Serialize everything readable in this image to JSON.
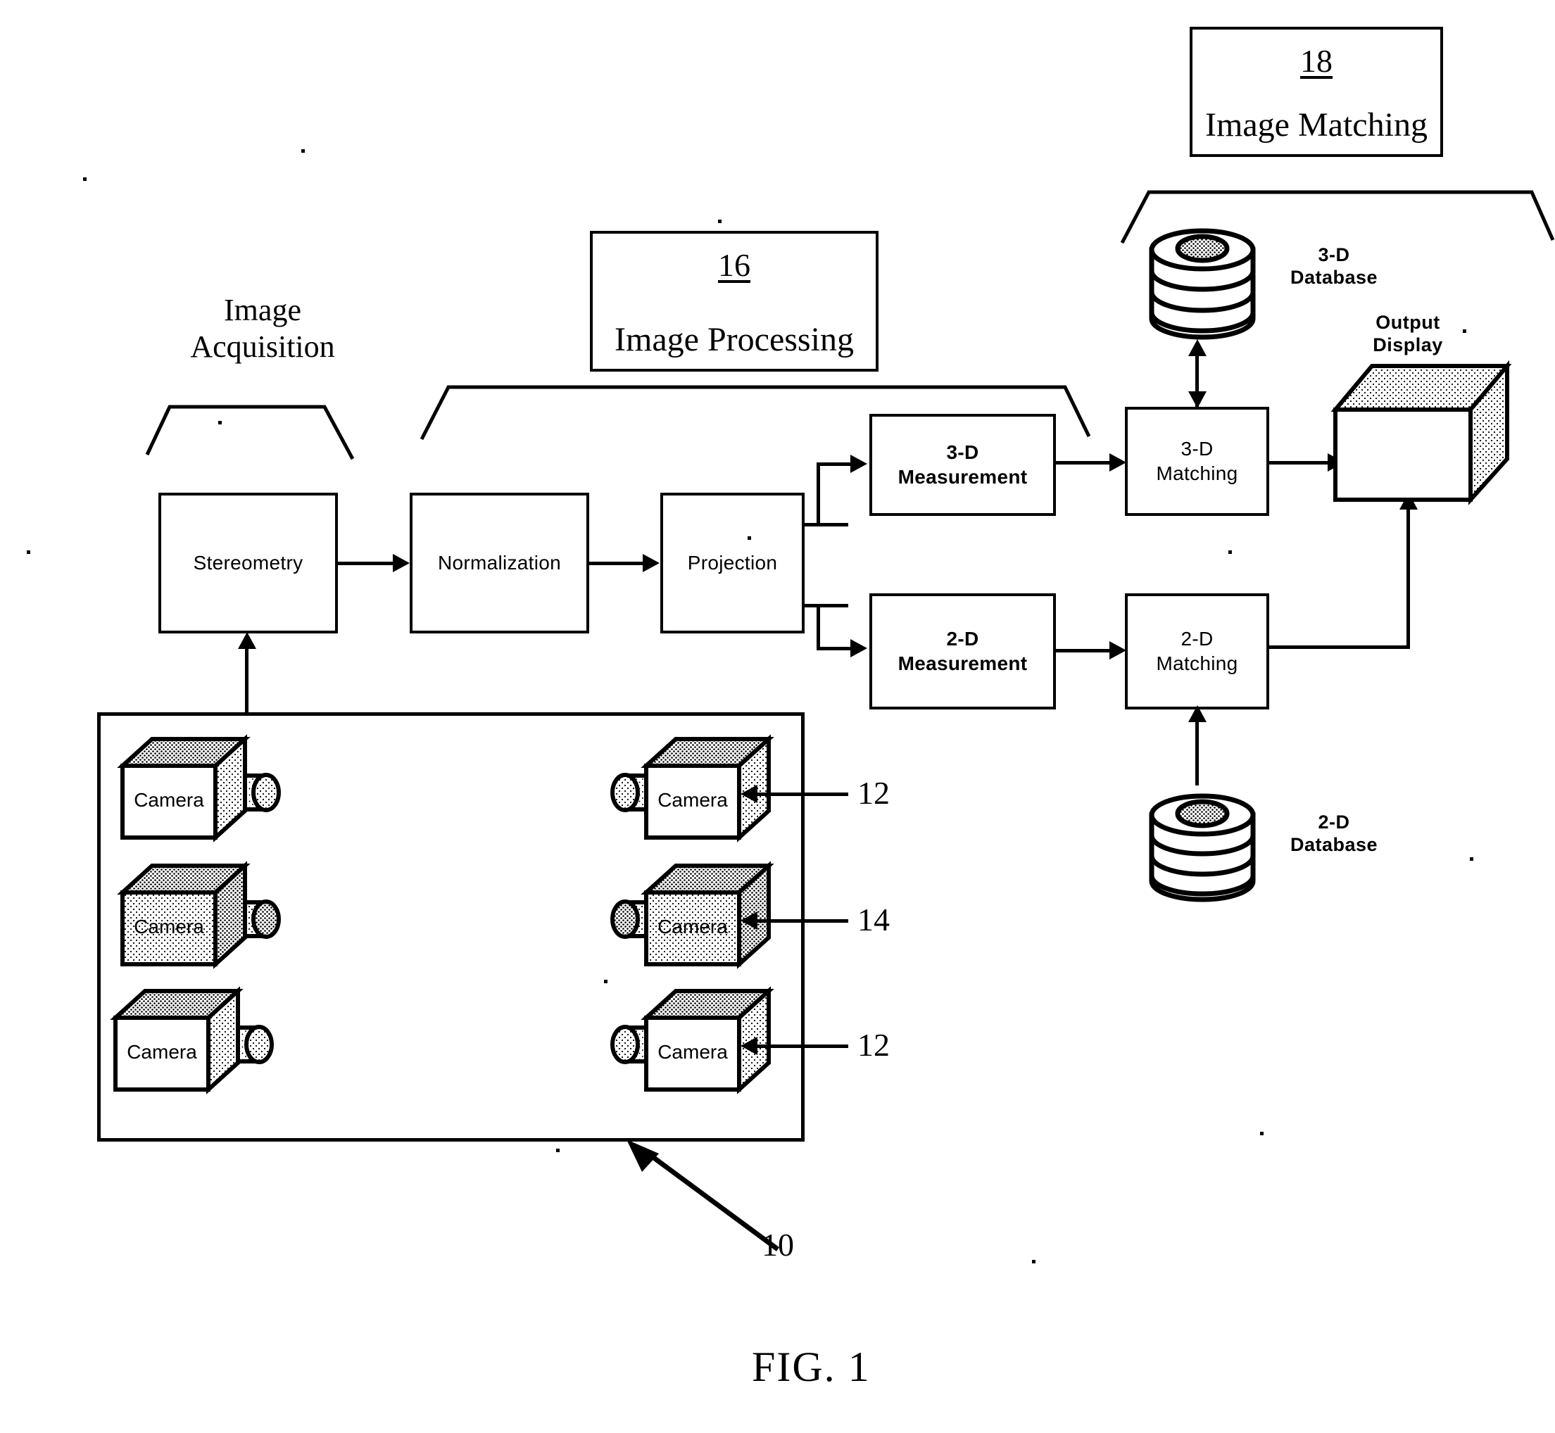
{
  "figure": {
    "caption": "FIG. 1",
    "reference_numbers": {
      "system": "10",
      "camera_a": "12",
      "camera_b": "14",
      "camera_c": "12",
      "image_processing": "16",
      "image_matching": "18"
    }
  },
  "groups": {
    "image_acquisition": {
      "label": "Image\nAcquisition"
    },
    "image_processing": {
      "number": "16",
      "title": "Image Processing"
    },
    "image_matching": {
      "number": "18",
      "title": "Image Matching"
    }
  },
  "process_boxes": {
    "stereometry": "Stereometry",
    "normalization": "Normalization",
    "projection": "Projection",
    "measurement_3d": "3-D\nMeasurement",
    "matching_3d": "3-D\nMatching",
    "measurement_2d": "2-D\nMeasurement",
    "matching_2d": "2-D\nMatching"
  },
  "databases": {
    "db_3d": "3-D\nDatabase",
    "db_2d": "2-D\nDatabase"
  },
  "output": {
    "display": "Output\nDisplay"
  },
  "cameras": [
    {
      "label": "Camera",
      "side": "left",
      "row": 1,
      "shaded": false
    },
    {
      "label": "Camera",
      "side": "right",
      "row": 1,
      "shaded": false,
      "ref": "12"
    },
    {
      "label": "Camera",
      "side": "left",
      "row": 2,
      "shaded": true
    },
    {
      "label": "Camera",
      "side": "right",
      "row": 2,
      "shaded": true,
      "ref": "14"
    },
    {
      "label": "Camera",
      "side": "left",
      "row": 3,
      "shaded": false
    },
    {
      "label": "Camera",
      "side": "right",
      "row": 3,
      "shaded": false,
      "ref": "12"
    }
  ],
  "colors": {
    "ink": "#000000",
    "paper": "#ffffff",
    "shading": "#b5b5b5"
  }
}
